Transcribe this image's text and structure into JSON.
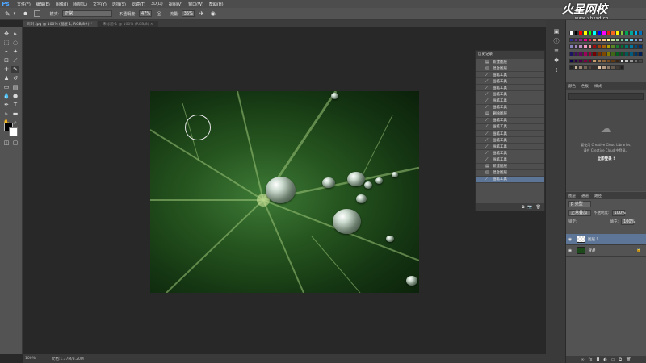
{
  "app": {
    "logo": "Ps"
  },
  "menu": [
    "文件(F)",
    "编辑(E)",
    "图像(I)",
    "图层(L)",
    "文字(Y)",
    "选择(S)",
    "滤镜(T)",
    "3D(D)",
    "视图(V)",
    "窗口(W)",
    "帮助(H)"
  ],
  "options": {
    "mode_label": "模式:",
    "mode_value": "正常",
    "opacity_label": "不透明度:",
    "opacity_value": "47%",
    "flow_label": "流量:",
    "flow_value": "35%"
  },
  "tabs": [
    {
      "label": "叶叶.jpg @ 100% (图层 1, RGB/8#) *",
      "active": true
    },
    {
      "label": "未标题-1 @ 100% (RGB/8) ×",
      "active": false
    }
  ],
  "status": {
    "zoom": "100%",
    "doc": "文档:1.37M/3.20M"
  },
  "history": {
    "title": "历史记录",
    "items": [
      "新建图层",
      "混合图层",
      "画笔工具",
      "画笔工具",
      "画笔工具",
      "画笔工具",
      "画笔工具",
      "画笔工具",
      "删除图层",
      "画笔工具",
      "画笔工具",
      "画笔工具",
      "画笔工具",
      "画笔工具",
      "画笔工具",
      "画笔工具",
      "新建图层",
      "混合图层",
      "画笔工具"
    ],
    "selected_index": 18
  },
  "libraries": {
    "tabs": [
      "颜色",
      "色板",
      "样式"
    ],
    "message_line1": "要使用 Creative Cloud Libraries,",
    "message_line2": "请在 Creative Cloud 中登录。",
    "login": "立即登录 !"
  },
  "layers": {
    "tabs": [
      "图层",
      "通道",
      "路径"
    ],
    "kind": "p 类型",
    "blend": "正常叠加",
    "opacity_label": "不透明度:",
    "opacity": "100%",
    "lock_label": "锁定:",
    "fill_label": "填充:",
    "fill": "100%",
    "items": [
      {
        "name": "图层 1",
        "selected": true
      },
      {
        "name": "背景",
        "selected": false,
        "italic": true
      }
    ]
  },
  "watermark": {
    "line1": "火星网校",
    "line2": "www.vhxsd.cn"
  },
  "swatch_colors": [
    "#ffffff",
    "#000000",
    "#ff0000",
    "#ffff00",
    "#00ff00",
    "#00ffff",
    "#0000ff",
    "#ff00ff",
    "#e61e1e",
    "#f26522",
    "#fff200",
    "#8dc63f",
    "#00a651",
    "#00a99d",
    "#00aeef",
    "#0072bc",
    "#2e3192",
    "#662d91",
    "#92278f",
    "#ec008c",
    "#ed145b",
    "#f7977a",
    "#f9ad81",
    "#fdc68a",
    "#fff79a",
    "#c4df9b",
    "#a3d39c",
    "#82ca9d",
    "#7bcdc8",
    "#6ecff6",
    "#7ea7d8",
    "#8493ca",
    "#8882be",
    "#a187be",
    "#bc8dbf",
    "#f49ac2",
    "#f6989d",
    "#9e0b0f",
    "#a0410d",
    "#a36209",
    "#aba000",
    "#598527",
    "#1a7b30",
    "#007236",
    "#00746b",
    "#0076a3",
    "#004b80",
    "#003471",
    "#1b1464",
    "#440e62",
    "#630460",
    "#9e005d",
    "#9e0039",
    "#790000",
    "#7b2e00",
    "#7d4900",
    "#827b00",
    "#406618",
    "#005e20",
    "#005826",
    "#005952",
    "#005b7f",
    "#003663",
    "#002157",
    "#0d004c",
    "#32004b",
    "#4b0049",
    "#7b0046",
    "#7a0026",
    "#c69c6d",
    "#a67c52",
    "#8c6239",
    "#754c24",
    "#603913",
    "#3c2415",
    "#ebebeb",
    "#c2c2c2",
    "#999999",
    "#707070",
    "#474747",
    "#262626",
    "#c7b299",
    "#998675",
    "#736357",
    "#534741",
    "#362f2d",
    "#e3c7ab",
    "#b79d85",
    "#8c7a6b",
    "#655a50",
    "#423b36",
    "#252120"
  ]
}
